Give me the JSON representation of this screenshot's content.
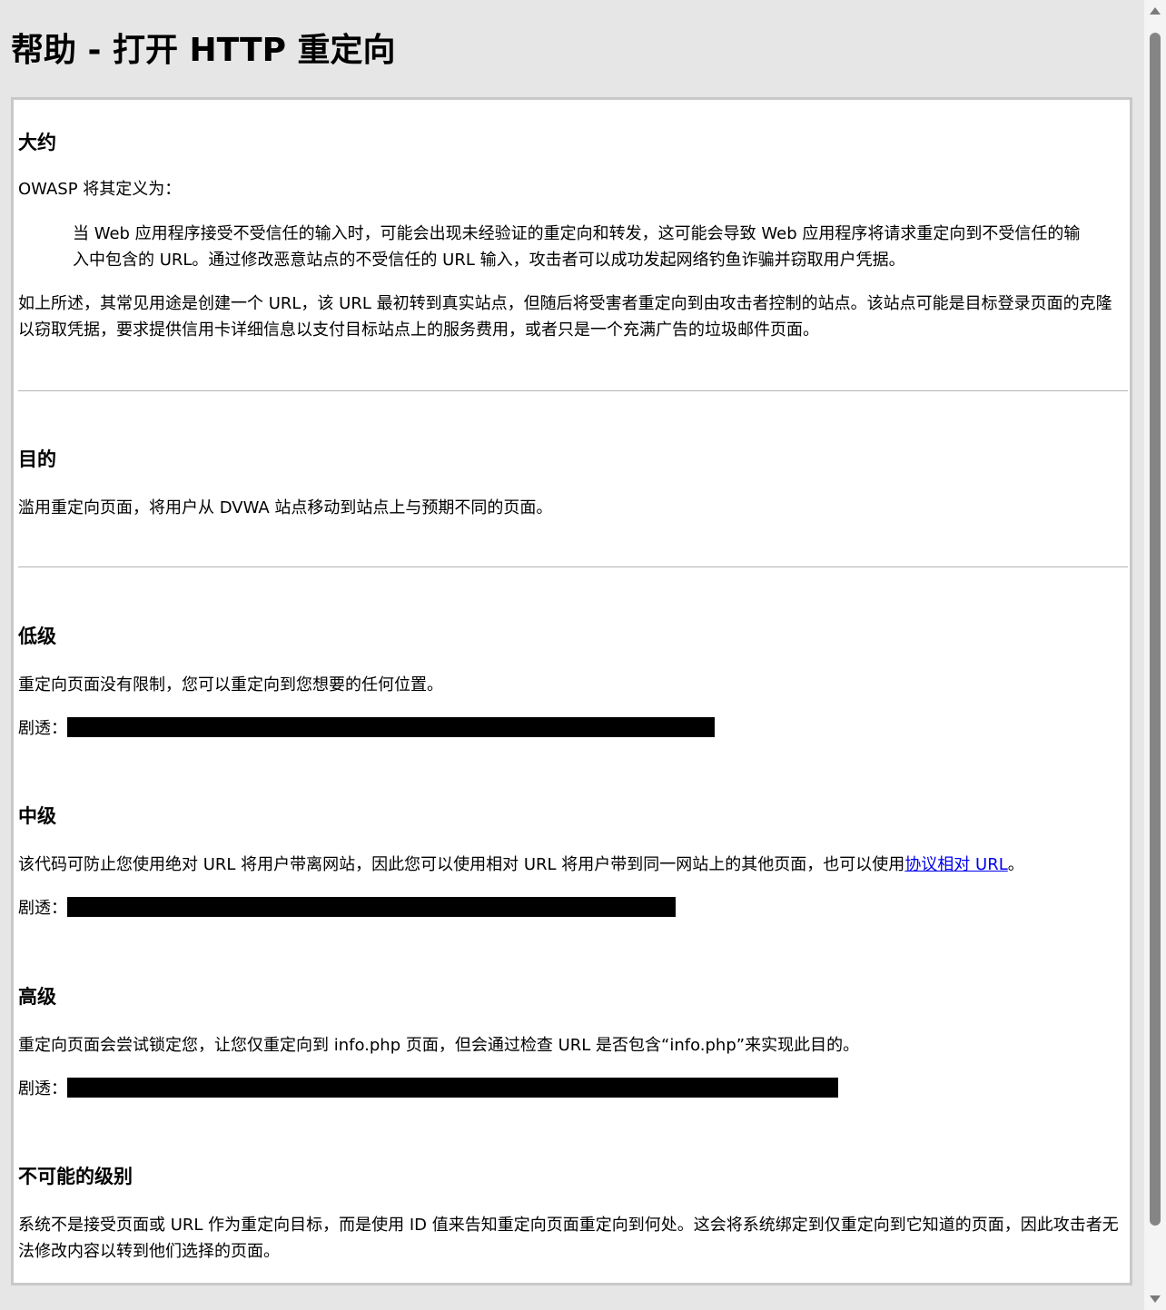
{
  "page_title": "帮助 - 打开 HTTP 重定向",
  "about": {
    "heading": "大约",
    "intro": "OWASP 将其定义为：",
    "quote": "当 Web 应用程序接受不受信任的输入时，可能会出现未经验证的重定向和转发，这可能会导致 Web 应用程序将请求重定向到不受信任的输入中包含的 URL。通过修改恶意站点的不受信任的 URL 输入，攻击者可以成功发起网络钓鱼诈骗并窃取用户凭据。",
    "body": "如上所述，其常见用途是创建一个 URL，该 URL 最初转到真实站点，但随后将受害者重定向到由攻击者控制的站点。该站点可能是目标登录页面的克隆以窃取凭据，要求提供信用卡详细信息以支付目标站点上的服务费用，或者只是一个充满广告的垃圾邮件页面。"
  },
  "objective": {
    "heading": "目的",
    "body": "滥用重定向页面，将用户从 DVWA 站点移动到站点上与预期不同的页面。"
  },
  "low": {
    "heading": "低级",
    "body": "重定向页面没有限制，您可以重定向到您想要的任何位置。",
    "spoiler_label": "剧透："
  },
  "medium": {
    "heading": "中级",
    "body_prefix": "该代码可防止您使用绝对 URL 将用户带离网站，因此您可以使用相对 URL 将用户带到同一网站上的其他页面，也可以使用",
    "link_text": "协议相对 URL",
    "body_suffix": "。",
    "spoiler_label": "剧透："
  },
  "high": {
    "heading": "高级",
    "body": "重定向页面会尝试锁定您，让您仅重定向到 info.php 页面，但会通过检查 URL 是否包含“info.php”来实现此目的。",
    "spoiler_label": "剧透："
  },
  "impossible": {
    "heading": "不可能的级别",
    "body": "系统不是接受页面或 URL 作为重定向目标，而是使用 ID 值来告知重定向页面重定向到何处。这会将系统绑定到仅重定向到它知道的页面，因此攻击者无法修改内容以转到他们选择的页面。"
  },
  "colors": {
    "page_background": "#e6e6e6",
    "panel_background": "#ffffff",
    "panel_border": "#c8c8c8",
    "link": "#0000ee",
    "spoiler": "#000000"
  }
}
